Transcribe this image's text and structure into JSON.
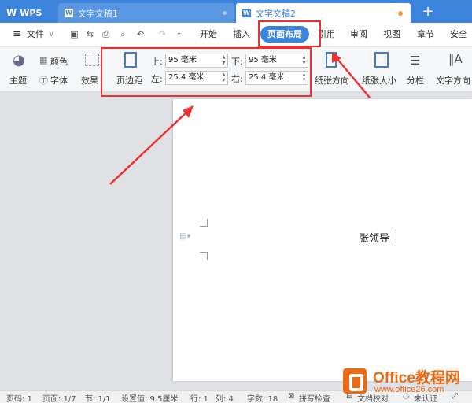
{
  "tabs": {
    "app": "WPS",
    "doc1": "文字文稿1",
    "doc2": "文字文稿2",
    "add": "+"
  },
  "menu": {
    "file": "文件",
    "items": [
      "开始",
      "插入",
      "页面布局",
      "引用",
      "审阅",
      "视图",
      "章节",
      "安全"
    ]
  },
  "ribbon": {
    "theme": "主题",
    "color": "颜色",
    "font": "字体",
    "effect": "效果",
    "margin": "页边距",
    "top_label": "上:",
    "top_value": "95 毫米",
    "bottom_label": "下:",
    "bottom_value": "95 毫米",
    "left_label": "左:",
    "left_value": "25.4 毫米",
    "right_label": "右:",
    "right_value": "25.4 毫米",
    "orientation": "纸张方向",
    "size": "纸张大小",
    "columns": "分栏",
    "text_direction": "文字方向"
  },
  "document": {
    "text": "张领导"
  },
  "status": {
    "page": "页码: 1",
    "pages": "页面: 1/7",
    "section": "节: 1/1",
    "setting": "设置值: 9.5厘米",
    "row": "行: 1",
    "col": "列: 4",
    "words": "字数: 18",
    "spell": "拼写检查",
    "proof": "文档校对",
    "auth": "未认证"
  },
  "watermark": {
    "title": "Office教程网",
    "url": "www.office26.com"
  },
  "colors": {
    "accent": "#3c83dc",
    "highlight": "#ee3030",
    "brand": "#ec6a14"
  }
}
